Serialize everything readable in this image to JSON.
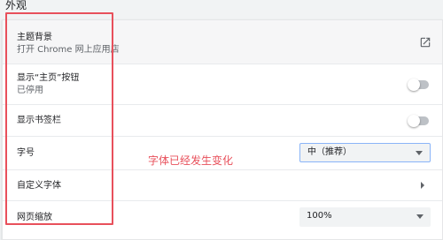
{
  "section": {
    "title": "外观"
  },
  "theme": {
    "label": "主题背景",
    "sublabel": "打开 Chrome 网上应用店",
    "icon": "open-in-new-icon"
  },
  "home_button": {
    "label": "显示“主页”按钮",
    "status": "已停用",
    "enabled": false
  },
  "bookmarks_bar": {
    "label": "显示书签栏",
    "enabled": false
  },
  "font_size": {
    "label": "字号",
    "selected": "中（推荐）"
  },
  "custom_fonts": {
    "label": "自定义字体",
    "icon": "chevron-right-icon"
  },
  "page_zoom": {
    "label": "网页缩放",
    "selected": "100%"
  },
  "annotation": {
    "text": "字体已经发生变化",
    "color": "#e8505b"
  },
  "colors": {
    "accent": "#8ab4f8",
    "annotation": "#e8505b"
  }
}
